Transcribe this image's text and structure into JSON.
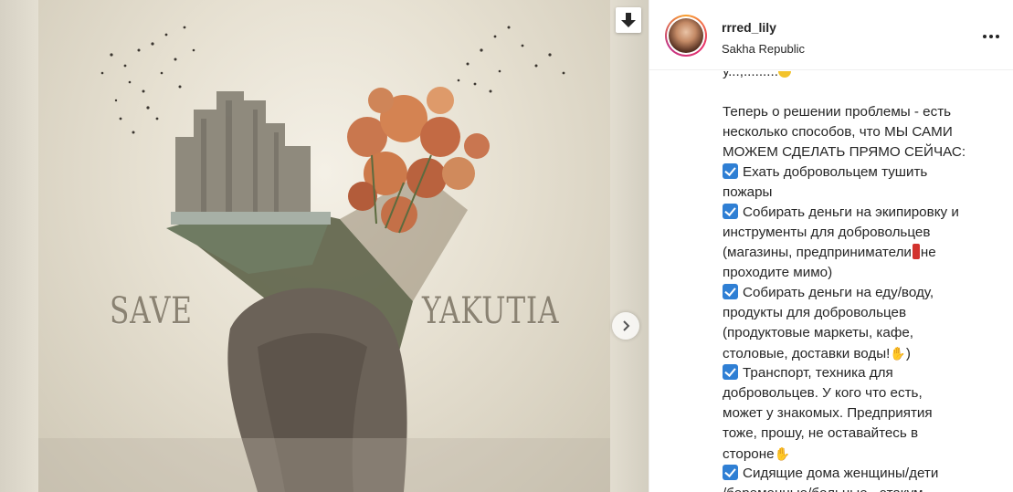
{
  "post": {
    "username": "rrred_lily",
    "location": "Sakha Republic",
    "image_words": {
      "left": "SAVE",
      "right": "YAKUTIA"
    },
    "icons": {
      "download": "download-arrow-icon",
      "next": "chevron-right-icon",
      "more": "more-options-icon"
    }
  },
  "caption": {
    "lines": [
      {
        "type": "clipped",
        "text": "у...,........."
      },
      {
        "type": "blank",
        "text": ""
      },
      {
        "type": "text",
        "text": "Теперь о решении проблемы - есть"
      },
      {
        "type": "text",
        "text": "несколько способов, что МЫ САМИ"
      },
      {
        "type": "text",
        "text": "МОЖЕМ СДЕЛАТЬ ПРЯМО СЕЙЧАС:"
      },
      {
        "type": "check",
        "text": "Ехать добровольцем тушить"
      },
      {
        "type": "text",
        "text": "пожары"
      },
      {
        "type": "check",
        "text": "Собирать деньги на экипировку и"
      },
      {
        "type": "text",
        "text": "инструменты для добровольцев"
      },
      {
        "type": "bang",
        "text": "(магазины, предприниматели",
        "after": "не"
      },
      {
        "type": "text",
        "text": "проходите мимо)"
      },
      {
        "type": "check",
        "text": "Собирать деньги на еду/воду,"
      },
      {
        "type": "text",
        "text": "продукты для добровольцев"
      },
      {
        "type": "text",
        "text": "(продуктовые маркеты, кафе,"
      },
      {
        "type": "pray",
        "text": "столовые, доставки воды!",
        "after": ")"
      },
      {
        "type": "check",
        "text": "Транспорт, техника для"
      },
      {
        "type": "text",
        "text": "добровольцев. У кого что есть,"
      },
      {
        "type": "text",
        "text": "может у знакомых. Предприятия"
      },
      {
        "type": "text",
        "text": "тоже, прошу, не оставайтесь в"
      },
      {
        "type": "pray",
        "text": "стороне",
        "after": ""
      },
      {
        "type": "check",
        "text": "Сидящие дома женщины/дети"
      },
      {
        "type": "text",
        "text": "/беременные/больные - этакум"
      }
    ]
  },
  "colors": {
    "accent_check": "#2f7fd4",
    "text": "#262626",
    "story_ring": [
      "#f9a12e",
      "#e8306a",
      "#c13584"
    ]
  }
}
